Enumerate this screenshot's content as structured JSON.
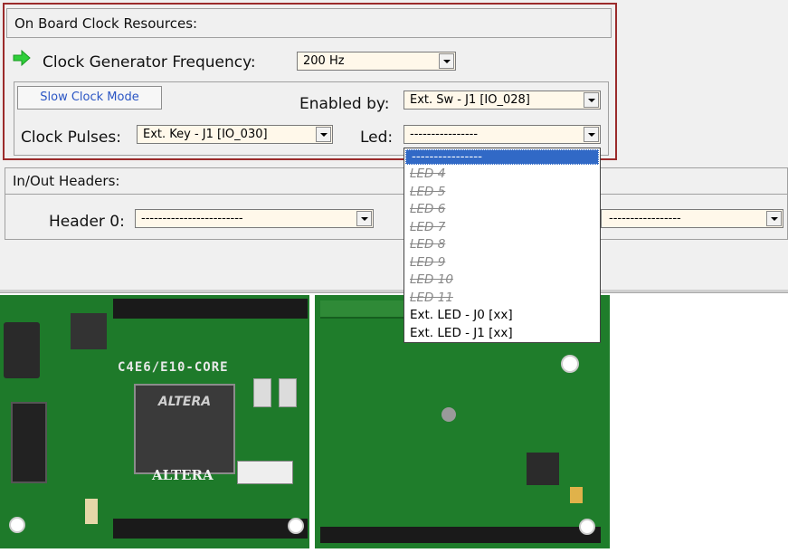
{
  "clock": {
    "title": "On Board Clock Resources:",
    "freq_label": "Clock Generator Frequency:",
    "freq_value": "200 Hz",
    "slow_btn": "Slow Clock Mode",
    "enabled_label": "Enabled by:",
    "enabled_value": "Ext. Sw - J1 [IO_028]",
    "pulses_label": "Clock Pulses:",
    "pulses_value": "Ext. Key - J1 [IO_030]",
    "led_label": "Led:",
    "led_value": "----------------"
  },
  "headers": {
    "title": "In/Out Headers:",
    "header0_label": "Header 0:",
    "header0_value": "------------------------",
    "header1_value": "-----------------"
  },
  "led_options": [
    {
      "label": "----------------",
      "state": "selected"
    },
    {
      "label": "LED 4",
      "state": "disabled"
    },
    {
      "label": "LED 5",
      "state": "disabled"
    },
    {
      "label": "LED 6",
      "state": "disabled"
    },
    {
      "label": "LED 7",
      "state": "disabled"
    },
    {
      "label": "LED 8",
      "state": "disabled"
    },
    {
      "label": "LED 9",
      "state": "disabled"
    },
    {
      "label": "LED 10",
      "state": "disabled"
    },
    {
      "label": "LED 11",
      "state": "disabled"
    },
    {
      "label": "Ext. LED - J0 [xx]",
      "state": "normal"
    },
    {
      "label": "Ext. LED - J1 [xx]",
      "state": "normal"
    }
  ],
  "board": {
    "model_text": "C4E6/E10-CORE",
    "chip_text": "ALTERA",
    "brand_text": "ALTERA"
  },
  "colors": {
    "group_border": "#9b2b2b",
    "combo_bg": "#fff8ea",
    "selection": "#3169c6",
    "pcb_green": "#1e7a2a",
    "arrow_icon": "#2fcf3a"
  },
  "icons": [
    "green-arrow-icon",
    "dropdown-arrow-icon"
  ]
}
